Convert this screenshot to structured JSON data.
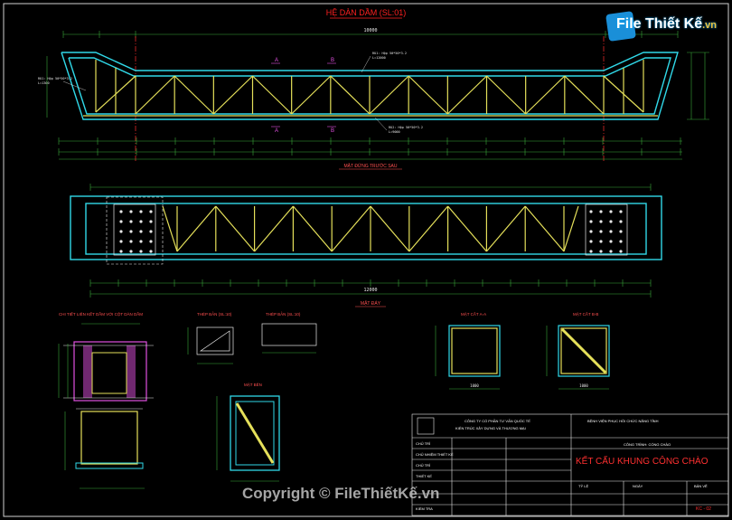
{
  "drawing": {
    "title": "HỆ DÀN DẦM (SL:01)",
    "elevation_caption": "MẶT ĐỨNG TRƯỚC SAU",
    "plan_caption": "MẶT ĐÁY",
    "detail_caption": "CHI TIẾT LIÊN KẾT DẦM VỚI CỘT DÀN DẦM",
    "plate1_caption": "THÉP BẢN (SL:10)",
    "plate2_caption": "THÉP BẢN (SL:10)",
    "section_a_caption": "MẶT CẮT A-A",
    "section_b_caption": "MẶT CẮT B-B",
    "side_caption": "MẶT BÊN",
    "top_dimension": "10000",
    "plan_dimension": "12000",
    "section_width": "1000",
    "section_a_marks": [
      "A",
      "A"
    ],
    "section_b_marks": [
      "B",
      "B"
    ],
    "member_labels": [
      "RU1: Hộp 50*50*3.2",
      "RU2: Hộp 50*50*3.2",
      "L=12000",
      "L=9000",
      "L=1300"
    ]
  },
  "title_block": {
    "company": "CÔNG TY CỔ PHẦN TƯ VẤN QUỐC TẾ",
    "company_sub": "KIẾN TRÚC XÂY DỰNG VÀ THƯƠNG MẠI",
    "client": "BỆNH VIỆN PHỤC HỒI CHỨC NĂNG TỈNH",
    "project_label": "CÔNG TRÌNH: CỔNG CHÀO",
    "drawing_name": "KẾT CẤU KHUNG CÔNG CHÀO",
    "sheet_code": "KC - 02",
    "rows": [
      "CHỦ TRÌ",
      "CHỦ NHIỆM THIẾT KẾ",
      "CHỦ TRÌ",
      "THIẾT KẾ",
      "KIỂM TRA"
    ],
    "scale_label": "TỶ LỆ",
    "date_label": "NGÀY",
    "sheet_label": "BẢN VẼ"
  },
  "brand": {
    "logo_text": "File Thiết Kế",
    "logo_suffix": ".vn",
    "watermark": "Copyright © FileThiếtKế.vn"
  },
  "colors": {
    "truss": "#e5e05a",
    "frame": "#30d8e8",
    "dimension": "#3aa83a",
    "annotation": "#ff5050",
    "section_mark": "#e050e0",
    "text": "#e8e8e8",
    "accent_red": "#ff2020"
  }
}
